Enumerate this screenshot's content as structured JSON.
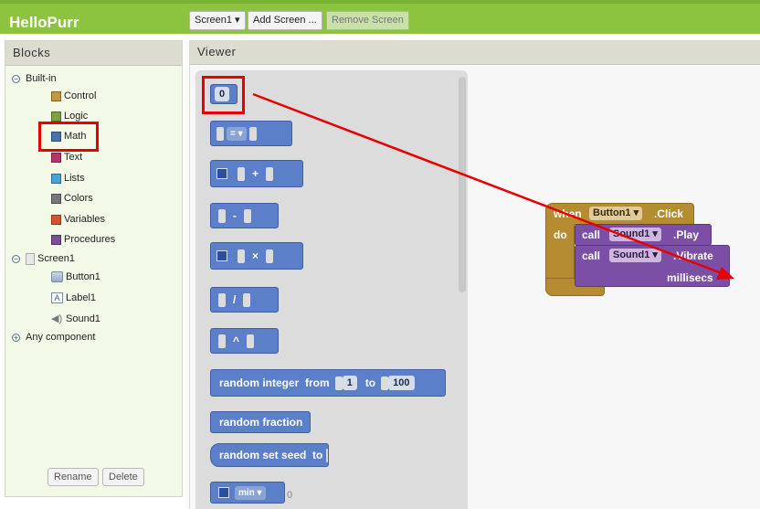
{
  "app": {
    "title": "HelloPurr"
  },
  "toolbar": {
    "screen_select": "Screen1 ▾",
    "add_screen": "Add Screen ...",
    "remove_screen": "Remove Screen"
  },
  "blocks_panel": {
    "header": "Blocks",
    "builtin": {
      "label": "Built-in",
      "items": [
        {
          "label": "Control",
          "color": "#c29a3e"
        },
        {
          "label": "Logic",
          "color": "#7ea33d"
        },
        {
          "label": "Math",
          "color": "#4c6fae"
        },
        {
          "label": "Text",
          "color": "#b6346a"
        },
        {
          "label": "Lists",
          "color": "#4aa3d6"
        },
        {
          "label": "Colors",
          "color": "#777777"
        },
        {
          "label": "Variables",
          "color": "#d2552e"
        },
        {
          "label": "Procedures",
          "color": "#7a5196"
        }
      ]
    },
    "screen": {
      "label": "Screen1",
      "items": [
        {
          "label": "Button1"
        },
        {
          "label": "Label1"
        },
        {
          "label": "Sound1"
        }
      ]
    },
    "any_component": "Any component",
    "rename": "Rename",
    "delete": "Delete"
  },
  "viewer": {
    "header": "Viewer",
    "math_blocks": {
      "number_value": "0",
      "compare_op": "= ▾",
      "plus": "+",
      "minus": "-",
      "times": "×",
      "divide": "/",
      "power": "^",
      "random_integer": "random integer  from",
      "random_from": "1",
      "random_to_label": "to",
      "random_to": "100",
      "random_fraction": "random fraction",
      "random_seed": "random set seed  to",
      "min_label": "min ▾",
      "min_trailing": "0"
    },
    "event": {
      "when": "when",
      "component": "Button1 ▾",
      "event_name": ".Click",
      "do": "do",
      "call1": "call",
      "call1_component": "Sound1 ▾",
      "call1_method": ".Play",
      "call2": "call",
      "call2_component": "Sound1 ▾",
      "call2_method": ".Vibrate",
      "param": "millisecs"
    }
  },
  "colors": {
    "topbar": "#8cc43f",
    "math": "#5b80c9",
    "control": "#b68c32",
    "procedure": "#7c4fa6",
    "highlight": "#e60000"
  }
}
